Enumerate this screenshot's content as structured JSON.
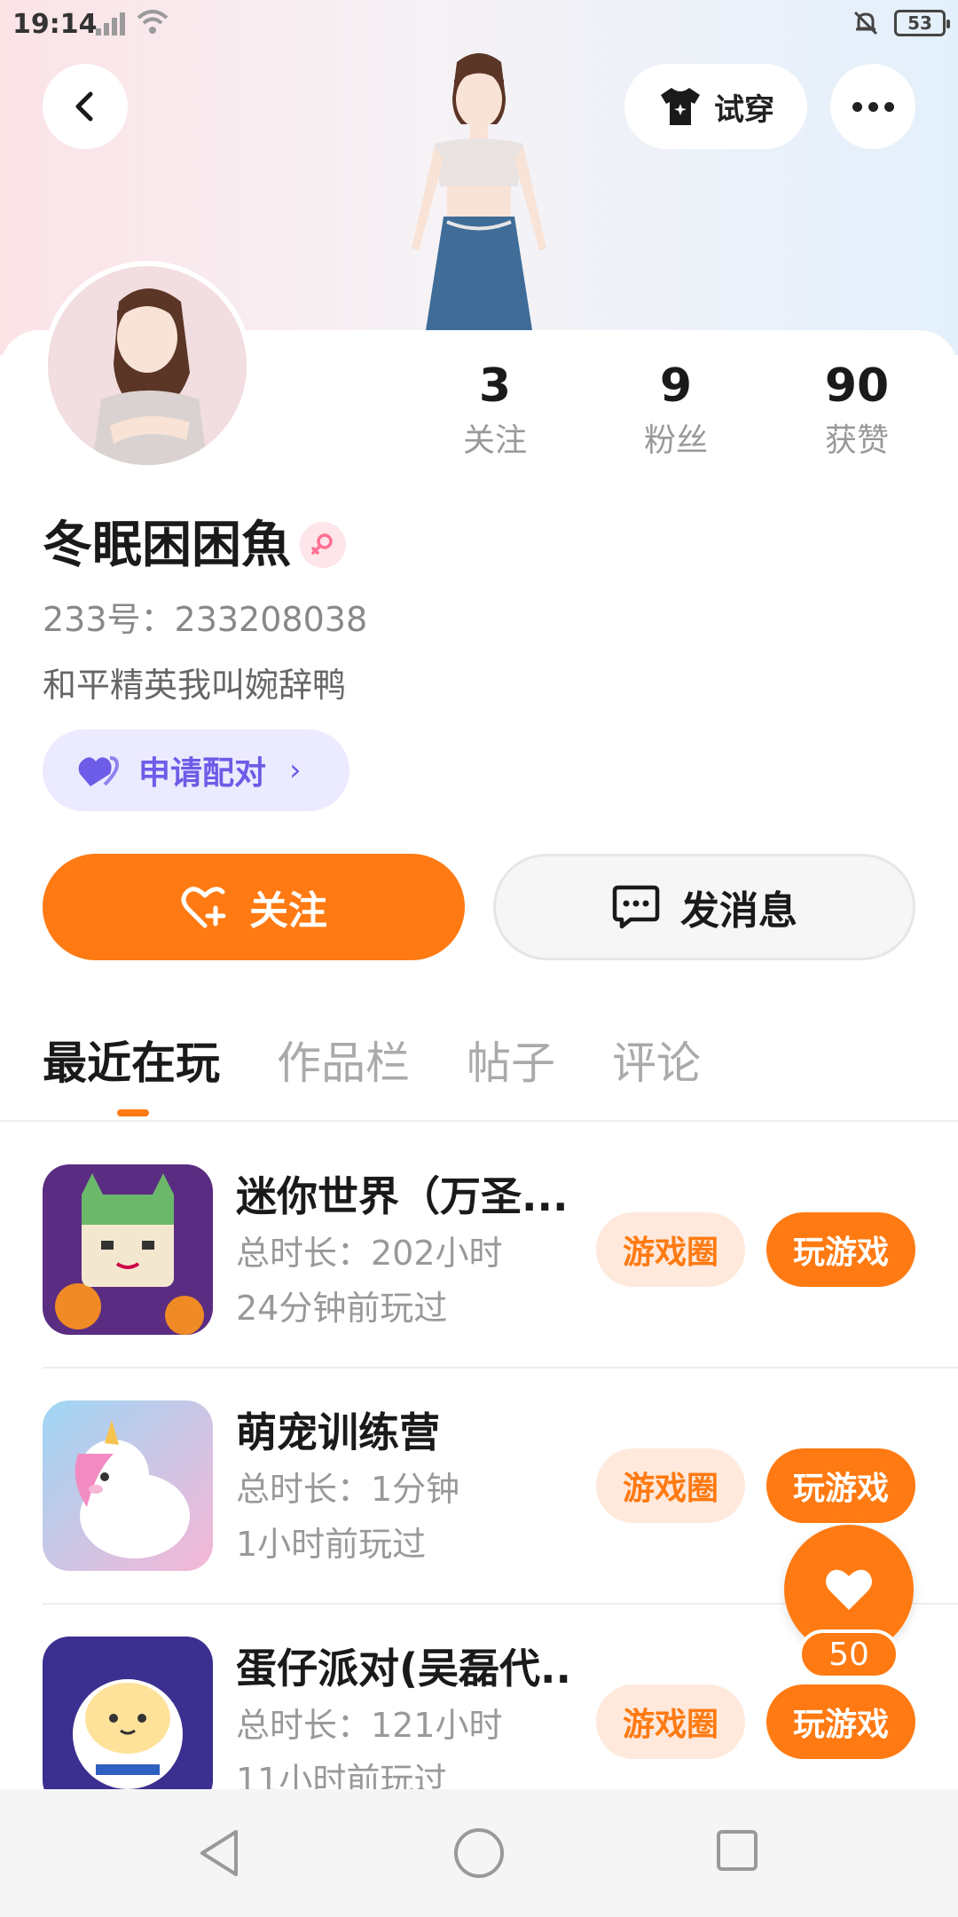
{
  "status_bar": {
    "time": "19:14",
    "battery": "53"
  },
  "header": {
    "try_on_label": "试穿"
  },
  "profile": {
    "username": "冬眠困困魚",
    "uid_text": "233号：233208038",
    "bio": "和平精英我叫婉辞鸭",
    "pair_label": "申请配对",
    "stats": [
      {
        "value": "3",
        "label": "关注"
      },
      {
        "value": "9",
        "label": "粉丝"
      },
      {
        "value": "90",
        "label": "获赞"
      }
    ]
  },
  "actions": {
    "follow_label": "关注",
    "message_label": "发消息"
  },
  "tabs": [
    {
      "label": "最近在玩"
    },
    {
      "label": "作品栏"
    },
    {
      "label": "帖子"
    },
    {
      "label": "评论"
    }
  ],
  "games": [
    {
      "name": "迷你世界（万圣...",
      "duration": "总时长：202小时",
      "last_played": "24分钟前玩过",
      "circle_label": "游戏圈",
      "play_label": "玩游戏"
    },
    {
      "name": "萌宠训练营",
      "duration": "总时长：1分钟",
      "last_played": "1小时前玩过",
      "circle_label": "游戏圈",
      "play_label": "玩游戏"
    },
    {
      "name": "蛋仔派对(吴磊代...",
      "duration": "总时长：121小时",
      "last_played": "11小时前玩过",
      "circle_label": "游戏圈",
      "play_label": "玩游戏"
    }
  ],
  "fab": {
    "count": "50"
  },
  "colors": {
    "accent": "#ff7a12",
    "pair_text": "#6c5ce7",
    "pair_bg": "#eceaff"
  },
  "icons": [
    "back-icon",
    "tshirt-icon",
    "more-icon",
    "heart-plus-icon",
    "chat-icon",
    "heart-icon",
    "female-icon"
  ]
}
